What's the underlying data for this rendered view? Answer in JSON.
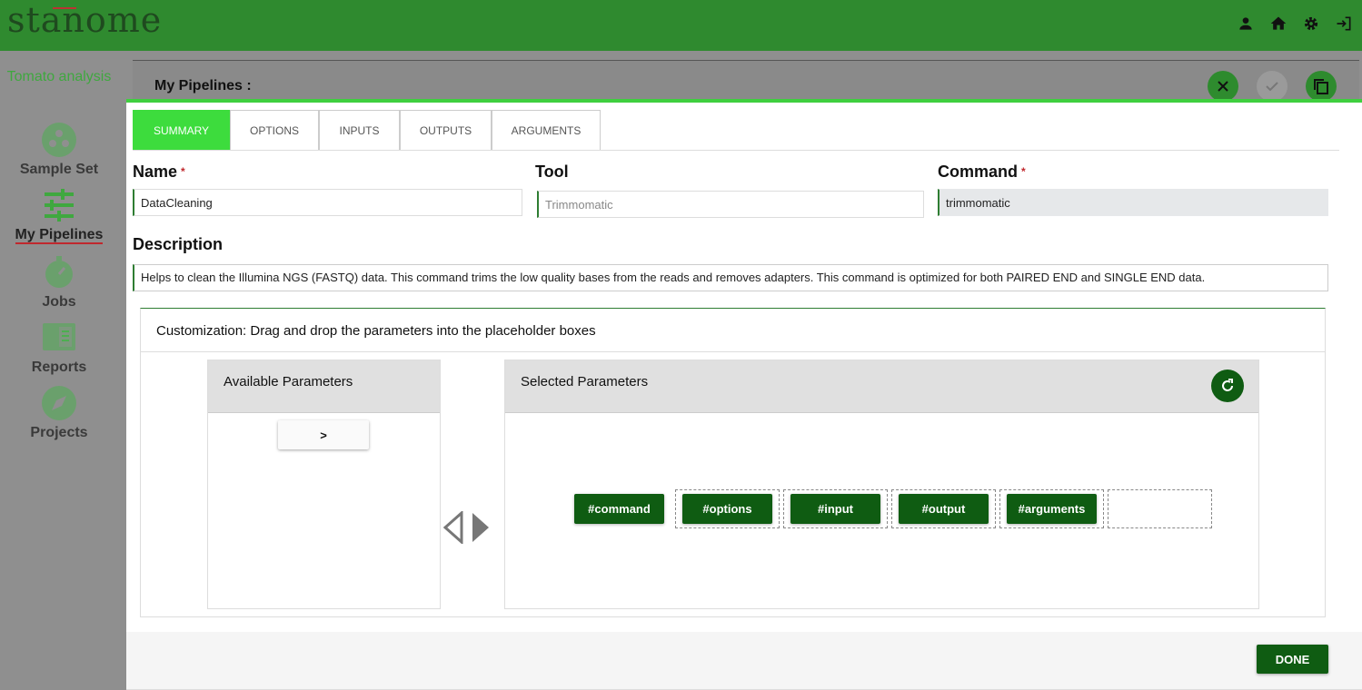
{
  "app": {
    "logo": "stanome"
  },
  "header_icons": [
    "user-icon",
    "home-icon",
    "gear-icon",
    "logout-icon"
  ],
  "sidebar": {
    "project_name": "Tomato analysis",
    "items": [
      {
        "label": "Sample Set",
        "icon": "sample-set-icon"
      },
      {
        "label": "My Pipelines",
        "icon": "sliders-icon",
        "active": true
      },
      {
        "label": "Jobs",
        "icon": "stopwatch-icon"
      },
      {
        "label": "Reports",
        "icon": "report-icon"
      },
      {
        "label": "Projects",
        "icon": "compass-icon"
      }
    ]
  },
  "page": {
    "title": "My Pipelines :"
  },
  "modal": {
    "tabs": [
      "SUMMARY",
      "OPTIONS",
      "INPUTS",
      "OUTPUTS",
      "ARGUMENTS"
    ],
    "active_tab": "SUMMARY",
    "fields": {
      "name": {
        "label": "Name",
        "required_mark": "*",
        "value": "DataCleaning"
      },
      "tool": {
        "label": "Tool",
        "placeholder": "Trimmomatic"
      },
      "command": {
        "label": "Command",
        "required_mark": "*",
        "value": "trimmomatic"
      },
      "description": {
        "label": "Description",
        "value": "Helps to clean the Illumina NGS (FASTQ) data. This command trims the low quality bases from the reads and removes adapters. This command is optimized for both PAIRED END and SINGLE END data."
      }
    },
    "customization": {
      "title": "Customization: Drag and drop the parameters into the placeholder boxes",
      "available": {
        "title": "Available Parameters",
        "items": [
          ">"
        ]
      },
      "selected": {
        "title": "Selected Parameters",
        "chips": [
          "#command",
          "#options",
          "#input",
          "#output",
          "#arguments"
        ]
      }
    },
    "done_label": "DONE"
  },
  "colors": {
    "header": "#2f8a2f",
    "accent": "#3ddc3d",
    "dark_green": "#0f5c12",
    "required": "#c0282d"
  }
}
